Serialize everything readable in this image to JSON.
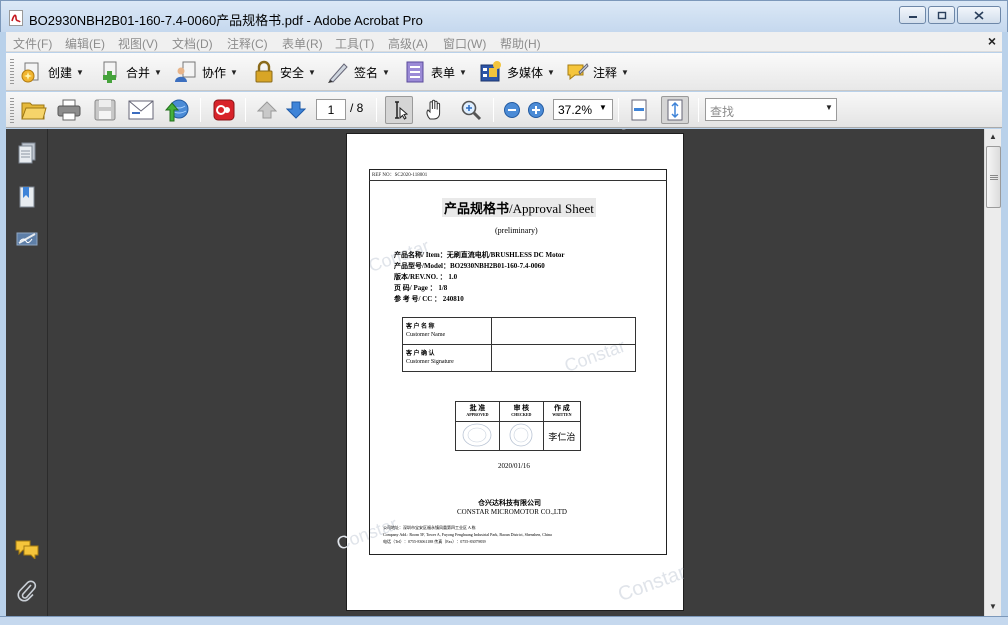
{
  "window": {
    "title": "BO2930NBH2B01-160-7.4-0060产品规格书.pdf - Adobe Acrobat Pro"
  },
  "menu": [
    "文件(F)",
    "编辑(E)",
    "视图(V)",
    "文档(D)",
    "注释(C)",
    "表单(R)",
    "工具(T)",
    "高级(A)",
    "窗口(W)",
    "帮助(H)"
  ],
  "tasks": [
    {
      "label": "创建",
      "icon": "create-icon"
    },
    {
      "label": "合并",
      "icon": "combine-icon"
    },
    {
      "label": "协作",
      "icon": "collaborate-icon"
    },
    {
      "label": "安全",
      "icon": "lock-icon"
    },
    {
      "label": "签名",
      "icon": "pen-icon"
    },
    {
      "label": "表单",
      "icon": "forms-icon"
    },
    {
      "label": "多媒体",
      "icon": "multimedia-icon"
    },
    {
      "label": "注释",
      "icon": "comment-icon"
    }
  ],
  "toolbar": {
    "current_page": "1",
    "total_pages": "/ 8",
    "zoom": "37.2%",
    "find_placeholder": "查找"
  },
  "document": {
    "ref_no": "REF NO：SC2020-118001",
    "title_cn": "产品规格书",
    "title_en": "/Approval Sheet",
    "subtitle": "(preliminary)",
    "info": [
      "产品名称/ Item：无刷直流电机/BRUSHLESS DC Motor",
      "产品型号/Model：BO2930NBH2B01-160-7.4-0060",
      "版本/REV.NO.  ： 1.0",
      "页    码/ Page ： 1/8",
      "参 考 号/ CC    ： 240810"
    ],
    "customer_name_cn": "客 户 名 称",
    "customer_name_en": "Customer Name",
    "customer_sign_cn": "客 户 确 认",
    "customer_sign_en": "Customer Signature",
    "approve": [
      {
        "cn": "批 准",
        "en": "APPROVED"
      },
      {
        "cn": "审 核",
        "en": "CHECKED"
      },
      {
        "cn": "作 成",
        "en": "WRITTEN"
      }
    ],
    "written_by": "李仁治",
    "date": "2020/01/16",
    "company_cn": "仓兴达科技有限公司",
    "company_en": "CONSTAR MICROMOTOR CO.,LTD",
    "address": [
      "公司地址：深圳市宝安区福永镇凤凰第四工业区 A 栋",
      "Company Add.: Room 5F, Tower A, Fuyong Fenghuang Industrial Park, Baoan District, Shenzhen, China",
      "电话（Tel）：0755-83061188          传真（Fax）：0755-83079839"
    ],
    "watermark": "Constar"
  }
}
